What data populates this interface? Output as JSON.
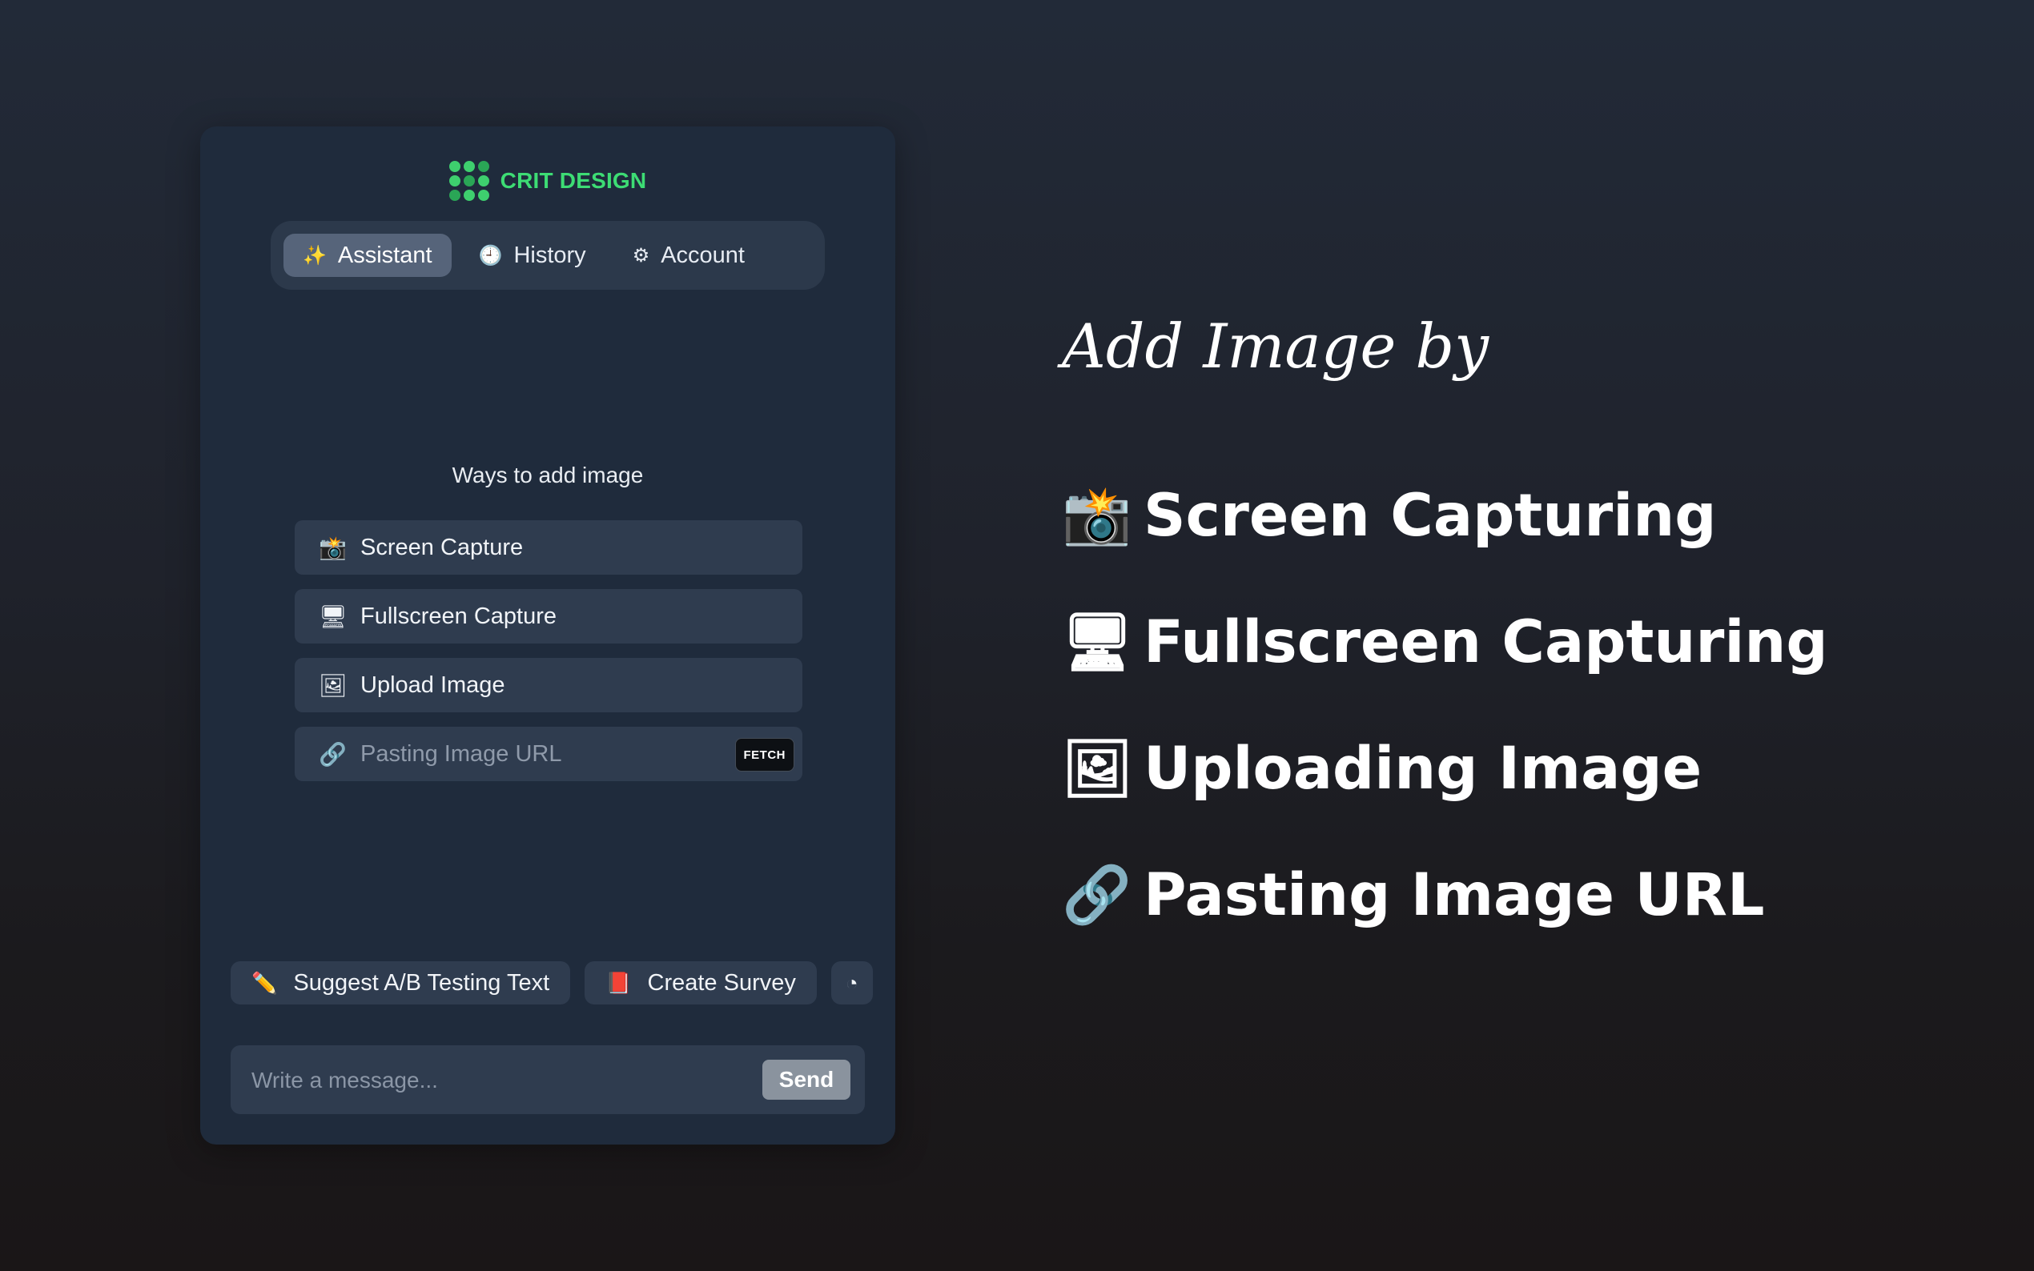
{
  "brand": {
    "name": "CRIT DESIGN",
    "logo_icon": "dot-grid-logo",
    "color": "#3ddc74"
  },
  "tabs": [
    {
      "label": "Assistant",
      "icon": "sparkles-icon",
      "glyph": "✨",
      "active": true
    },
    {
      "label": "History",
      "icon": "clock-icon",
      "glyph": "🕘",
      "active": false
    },
    {
      "label": "Account",
      "icon": "gear-icon",
      "glyph": "⚙",
      "active": false
    }
  ],
  "ways": {
    "title": "Ways to add image",
    "options": [
      {
        "label": "Screen Capture",
        "icon": "camera-flash-icon",
        "glyph": "📸"
      },
      {
        "label": "Fullscreen Capture",
        "icon": "desktop-computer-icon",
        "glyph": "🖥"
      },
      {
        "label": "Upload Image",
        "icon": "framed-picture-icon",
        "glyph": "🖼"
      }
    ],
    "url_input": {
      "placeholder": "Pasting Image URL",
      "icon": "link-icon",
      "glyph": "🔗",
      "button": "FETCH"
    }
  },
  "chips": [
    {
      "label": "Suggest A/B Testing Text",
      "icon": "pencil-icon",
      "glyph": "✏️"
    },
    {
      "label": "Create Survey",
      "icon": "red-book-icon",
      "glyph": "📕"
    },
    {
      "label": "",
      "icon": "partially-visible-chip-icon",
      "glyph": "◔"
    }
  ],
  "composer": {
    "placeholder": "Write a message...",
    "send_label": "Send"
  },
  "headline": "Add Image by",
  "features": [
    {
      "label": "Screen Capturing",
      "icon": "camera-flash-icon",
      "glyph": "📸"
    },
    {
      "label": "Fullscreen Capturing",
      "icon": "desktop-computer-icon",
      "glyph": "🖥"
    },
    {
      "label": "Uploading Image",
      "icon": "framed-picture-icon",
      "glyph": "🖼"
    },
    {
      "label": "Pasting Image URL",
      "icon": "link-icon",
      "glyph": "🔗"
    }
  ]
}
